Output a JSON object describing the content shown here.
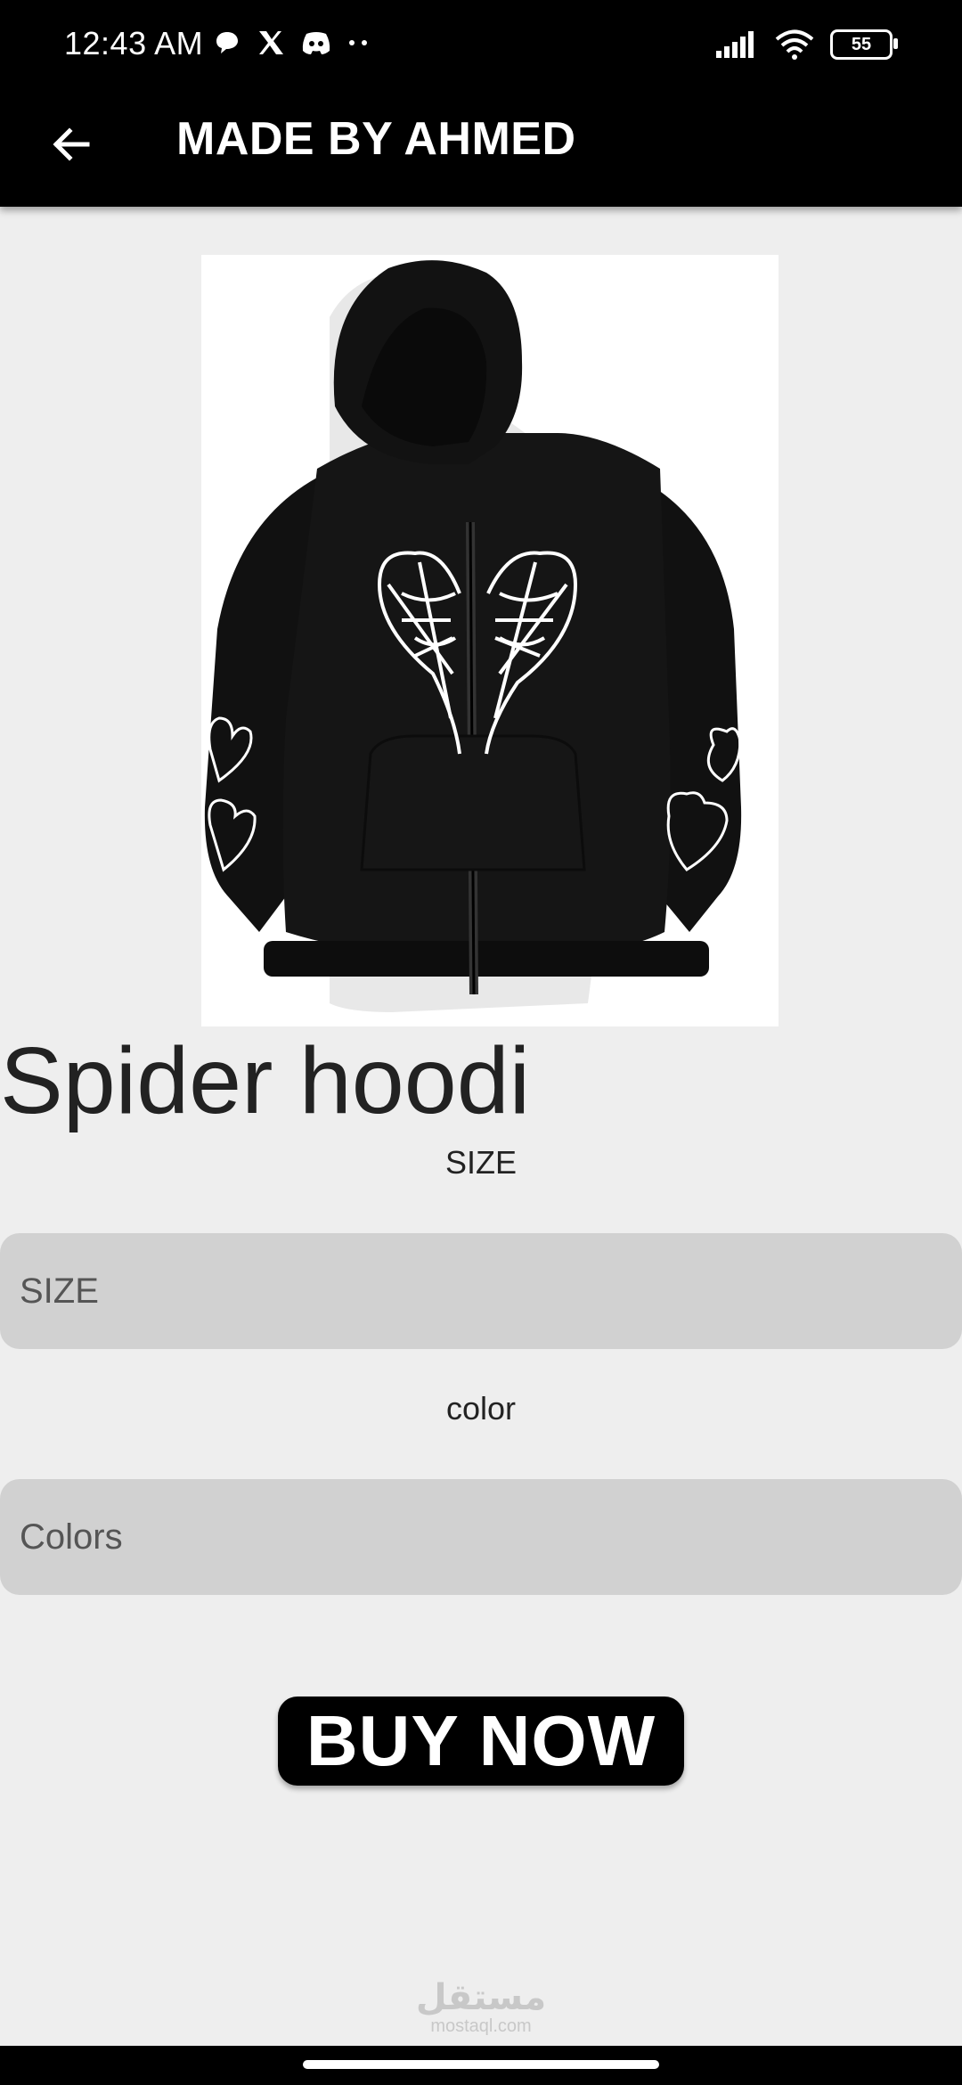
{
  "status_bar": {
    "time": "12:43 AM",
    "battery": "55",
    "left_icons": [
      "chat-bubble-icon",
      "x-logo-icon",
      "discord-icon",
      "more-dots-icon"
    ],
    "right_icons": [
      "signal-icon",
      "wifi-icon",
      "battery-icon"
    ]
  },
  "app_bar": {
    "title": "MADE BY AHMED",
    "back_icon": "arrow-left-icon",
    "background": "#000000"
  },
  "product": {
    "image_alt": "black zip hoodie with white spider web print",
    "name": "Spider hoodi"
  },
  "form": {
    "size_label": "SIZE",
    "size_placeholder": "SIZE",
    "color_label": "color",
    "color_placeholder": "Colors"
  },
  "actions": {
    "buy_label": "BUY NOW"
  },
  "watermark": {
    "arabic": "مستقل",
    "latin": "mostaql.com"
  }
}
